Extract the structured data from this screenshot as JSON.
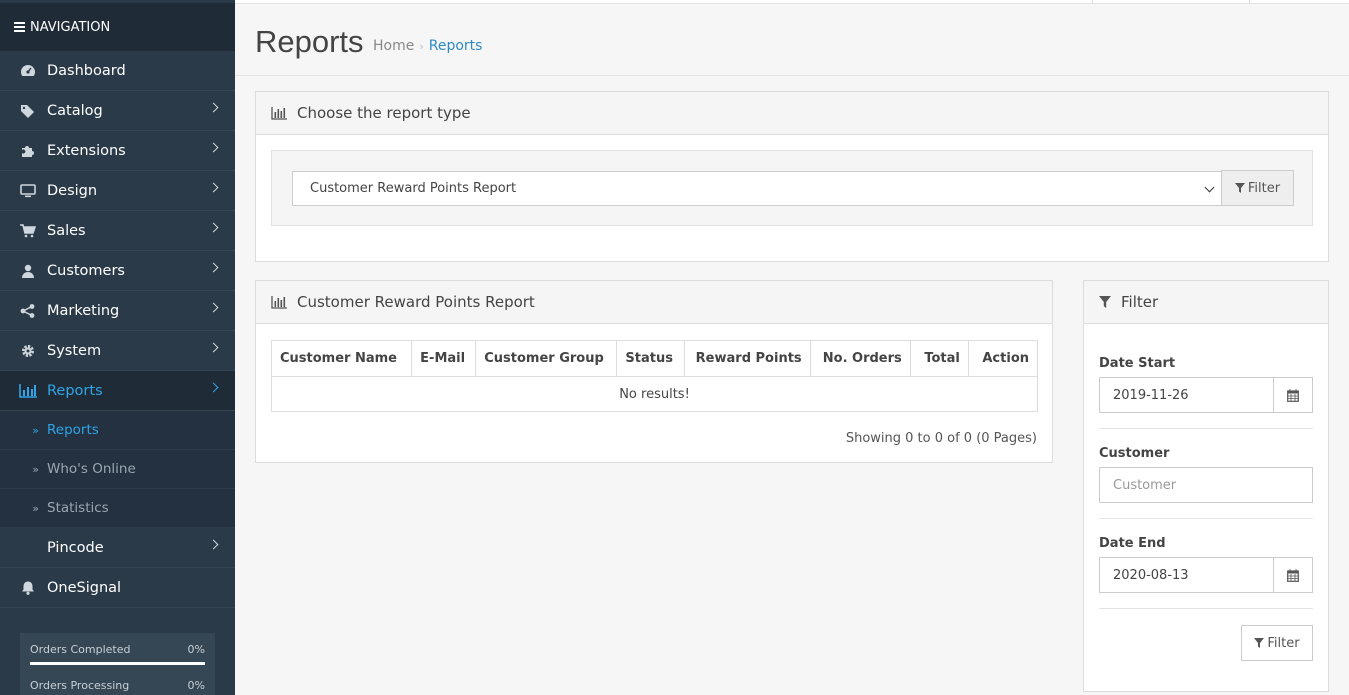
{
  "sidebar": {
    "header": "NAVIGATION",
    "items": [
      {
        "label": "Dashboard",
        "icon": "dashboard-icon"
      },
      {
        "label": "Catalog",
        "icon": "tags-icon"
      },
      {
        "label": "Extensions",
        "icon": "puzzle-icon"
      },
      {
        "label": "Design",
        "icon": "monitor-icon"
      },
      {
        "label": "Sales",
        "icon": "cart-icon"
      },
      {
        "label": "Customers",
        "icon": "user-icon"
      },
      {
        "label": "Marketing",
        "icon": "share-icon"
      },
      {
        "label": "System",
        "icon": "gear-icon"
      },
      {
        "label": "Reports",
        "icon": "bar-chart-icon"
      }
    ],
    "sub_items": [
      {
        "label": "Reports"
      },
      {
        "label": "Who's Online"
      },
      {
        "label": "Statistics"
      }
    ],
    "pincode": "Pincode",
    "onesignal": "OneSignal",
    "progress": [
      {
        "label": "Orders Completed",
        "value": "0%"
      },
      {
        "label": "Orders Processing",
        "value": "0%"
      }
    ]
  },
  "header": {
    "title": "Reports",
    "breadcrumb_home": "Home",
    "breadcrumb_sep": "›",
    "breadcrumb_current": "Reports"
  },
  "report_type": {
    "title": "Choose the report type",
    "selected": "Customer Reward Points Report",
    "filter_label": "Filter"
  },
  "report": {
    "title": "Customer Reward Points Report",
    "columns": [
      "Customer Name",
      "E-Mail",
      "Customer Group",
      "Status",
      "Reward Points",
      "No. Orders",
      "Total",
      "Action"
    ],
    "empty": "No results!",
    "pagination": "Showing 0 to 0 of 0 (0 Pages)"
  },
  "filter": {
    "title": "Filter",
    "date_start_label": "Date Start",
    "date_start": "2019-11-26",
    "customer_label": "Customer",
    "customer_placeholder": "Customer",
    "date_end_label": "Date End",
    "date_end": "2020-08-13",
    "button": "Filter"
  },
  "colors": {
    "accent": "#2fa4e7",
    "sidebar": "#2b3a48"
  }
}
